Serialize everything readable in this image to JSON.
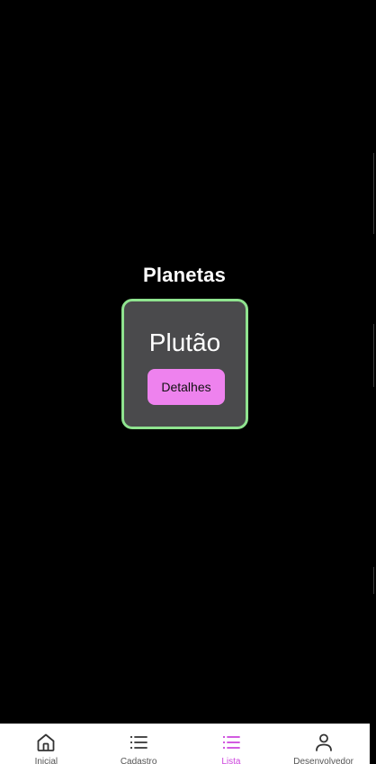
{
  "page": {
    "title": "Planetas"
  },
  "planet_card": {
    "name": "Plutão",
    "details_label": "Detalhes"
  },
  "tab_bar": {
    "tabs": [
      {
        "label": "Inicial",
        "icon": "home-icon",
        "active": false
      },
      {
        "label": "Cadastro",
        "icon": "list-icon",
        "active": false
      },
      {
        "label": "Lista",
        "icon": "list-icon",
        "active": true
      },
      {
        "label": "Desenvolvedor",
        "icon": "person-icon",
        "active": false
      }
    ]
  },
  "colors": {
    "background": "#000000",
    "card_background": "#4a4a4c",
    "card_border": "#8fe38f",
    "button_background": "#ee82ee",
    "tab_active": "#cc44dd",
    "tab_inactive": "#333333"
  }
}
